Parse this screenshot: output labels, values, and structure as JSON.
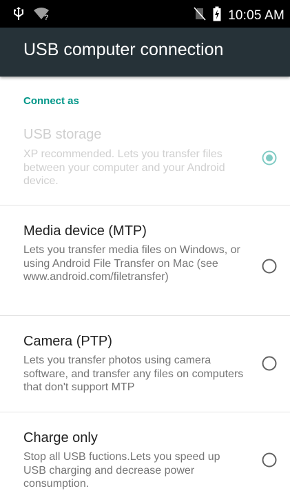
{
  "status_bar": {
    "time": "10:05 AM",
    "icons": [
      "usb-icon",
      "wifi-no-internet-icon",
      "no-sim-icon",
      "battery-charging-icon"
    ]
  },
  "app_bar": {
    "title": "USB computer connection"
  },
  "section": {
    "header": "Connect as"
  },
  "options": [
    {
      "title": "USB storage",
      "summary": "XP recommended. Lets you transfer files between your computer and your Android device.",
      "selected": true,
      "enabled": false
    },
    {
      "title": "Media device (MTP)",
      "summary": "Lets you transfer media files on Windows, or using Android File Transfer on Mac (see www.android.com/filetransfer)",
      "selected": false,
      "enabled": true
    },
    {
      "title": "Camera (PTP)",
      "summary": "Lets you transfer photos using camera software, and transfer any files on computers that don't support MTP",
      "selected": false,
      "enabled": true
    },
    {
      "title": "Charge only",
      "summary": "Stop all USB fuctions.Lets you speed up USB charging and decrease power consumption.",
      "selected": false,
      "enabled": true
    }
  ],
  "colors": {
    "status_bar": "#000000",
    "app_bar": "#263238",
    "accent": "#009688",
    "radio_outline": "#616161",
    "disabled_text": "#cfcfcf"
  }
}
